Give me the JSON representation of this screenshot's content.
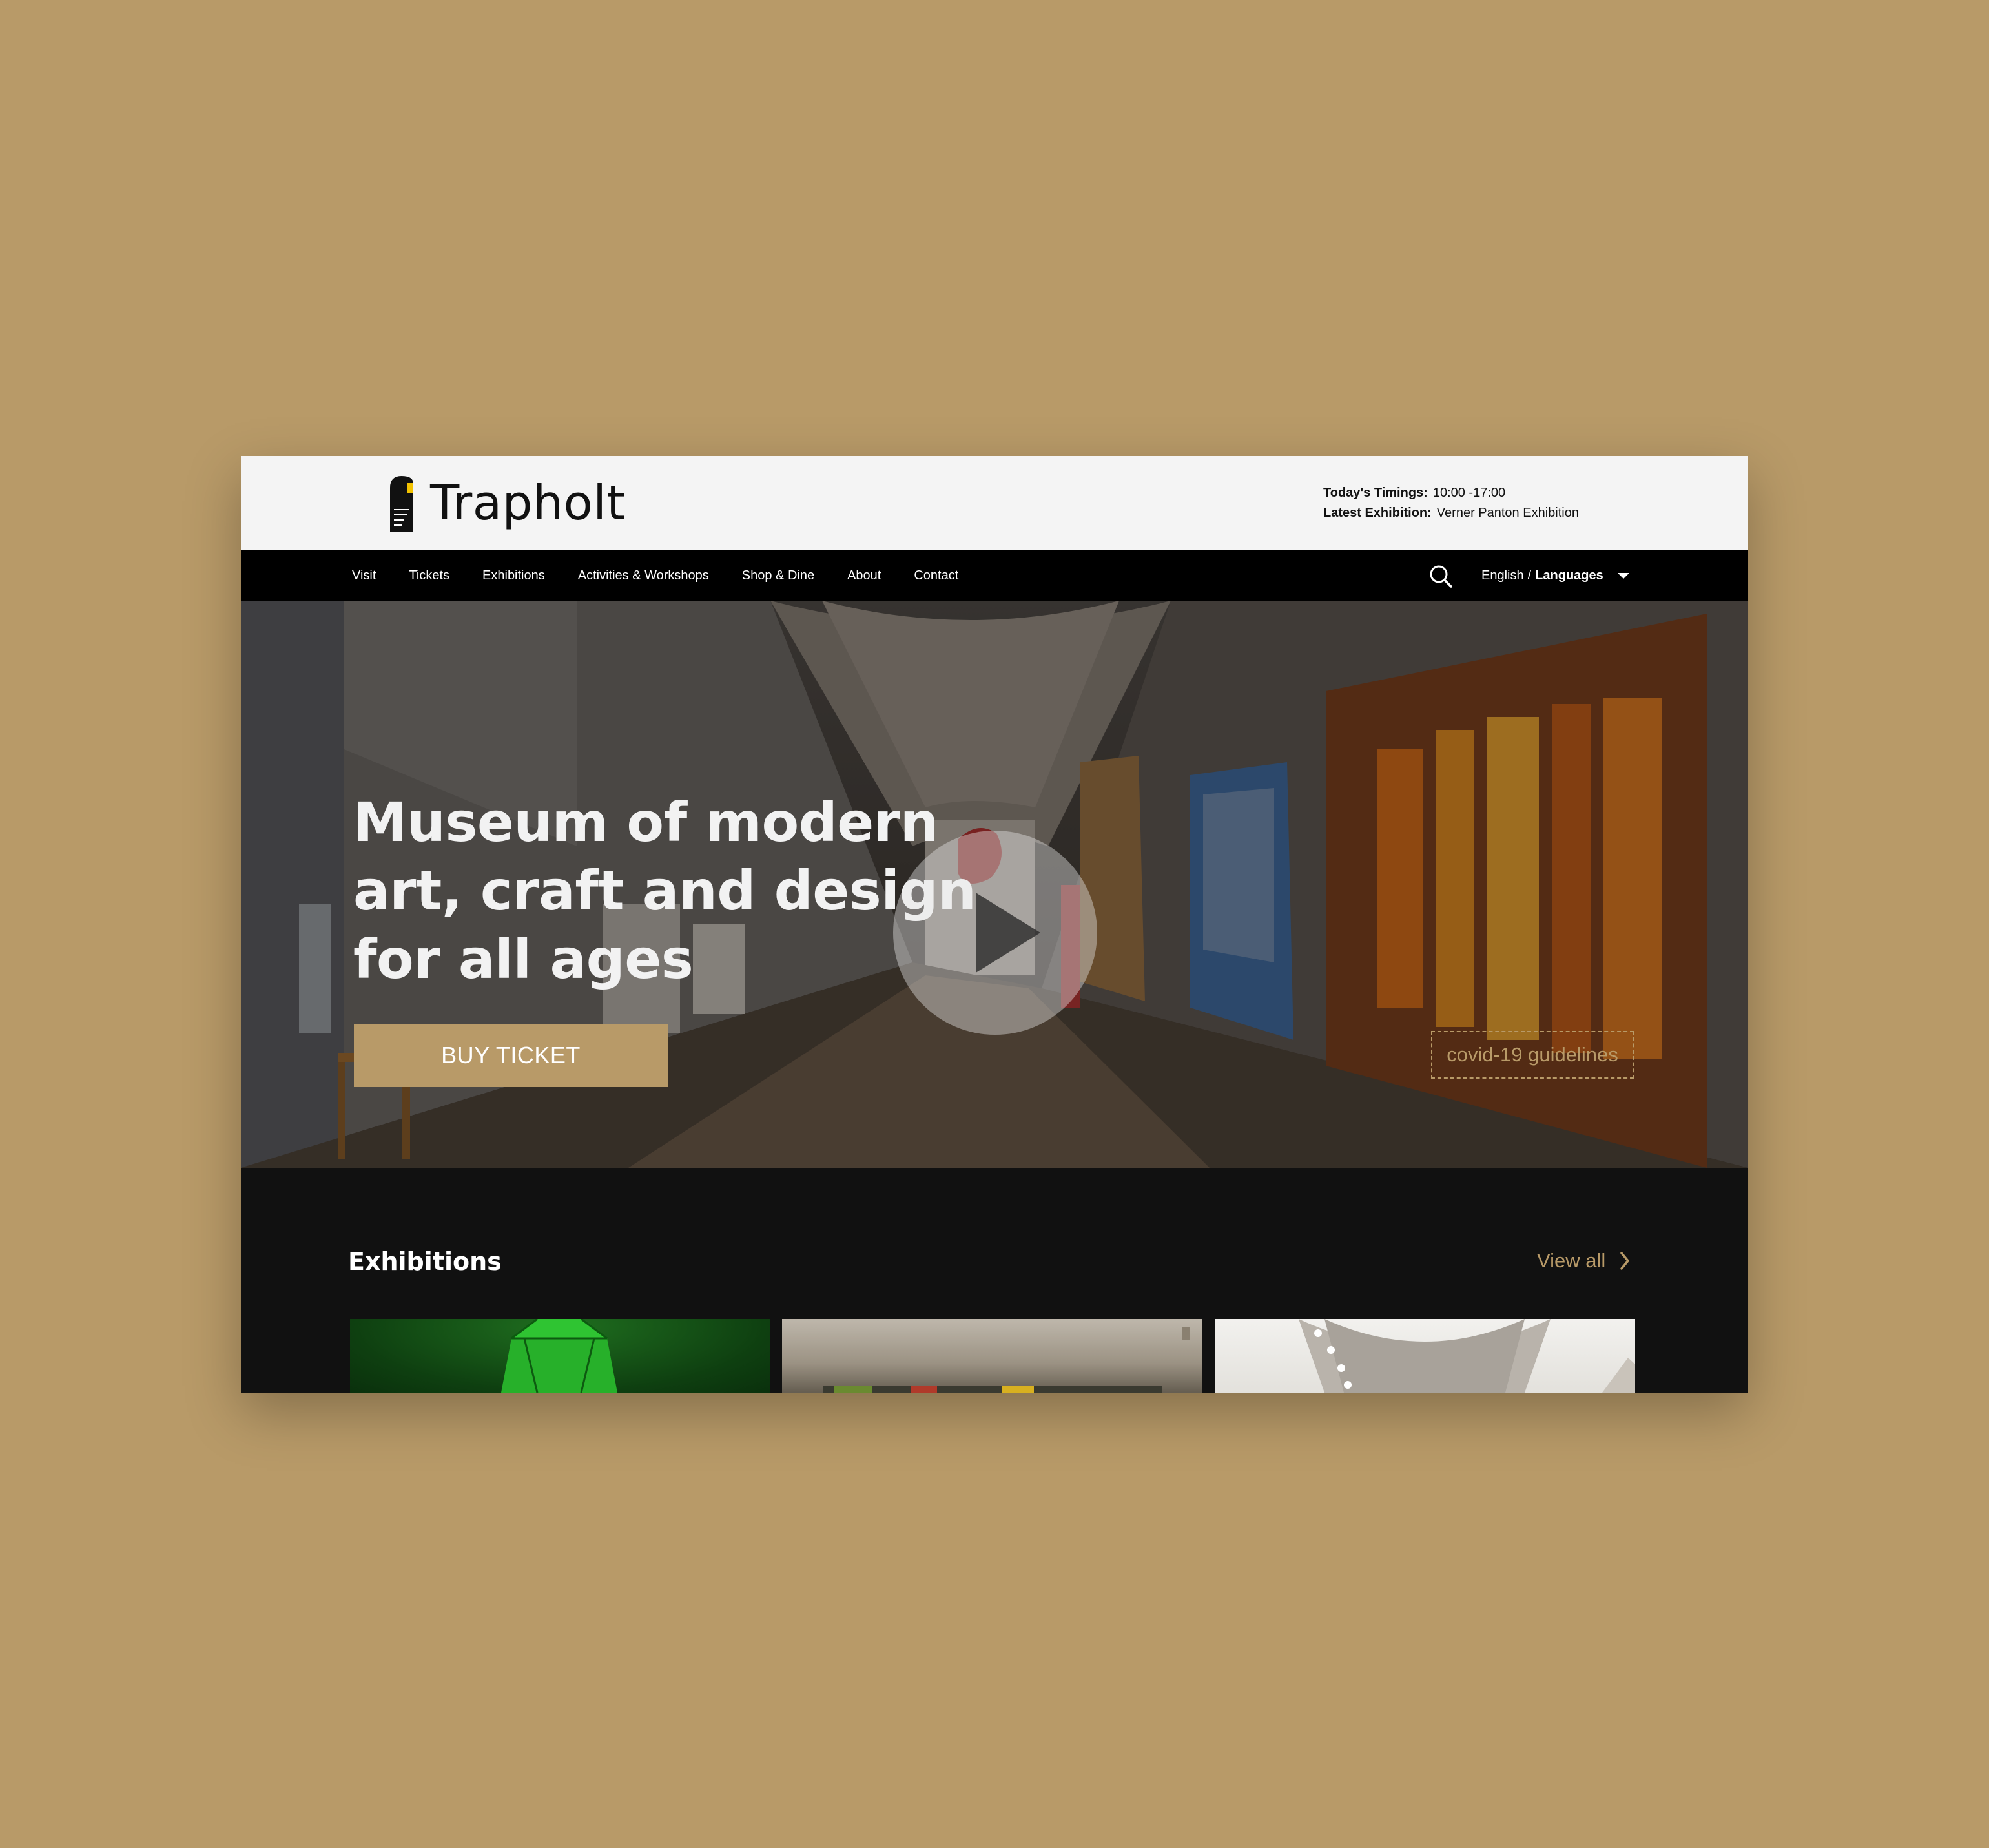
{
  "brand": {
    "name": "Trapholt"
  },
  "info": {
    "timings_label": "Today's Timings:",
    "timings_value": "10:00 -17:00",
    "exhibition_label": "Latest Exhibition:",
    "exhibition_value": "Verner Panton Exhibition"
  },
  "nav": {
    "items": [
      {
        "label": "Visit"
      },
      {
        "label": "Tickets"
      },
      {
        "label": "Exhibitions"
      },
      {
        "label": "Activities & Workshops"
      },
      {
        "label": "Shop & Dine"
      },
      {
        "label": "About"
      },
      {
        "label": "Contact"
      }
    ],
    "language_current": "English",
    "language_separator": "/",
    "language_label": "Languages"
  },
  "hero": {
    "title": "Museum of modern art, craft and design for all ages",
    "buy_label": "BUY TICKET",
    "covid_label": "covid-19 guidelines"
  },
  "exhibitions": {
    "title": "Exhibitions",
    "view_all_label": "View all"
  },
  "colors": {
    "accent": "#b89a68",
    "nav_bg": "#000000",
    "header_bg": "#f4f4f4",
    "section_bg": "#111111"
  },
  "icons": [
    "logo-mark-icon",
    "search-icon",
    "caret-down-icon",
    "play-icon",
    "chevron-right-icon"
  ]
}
